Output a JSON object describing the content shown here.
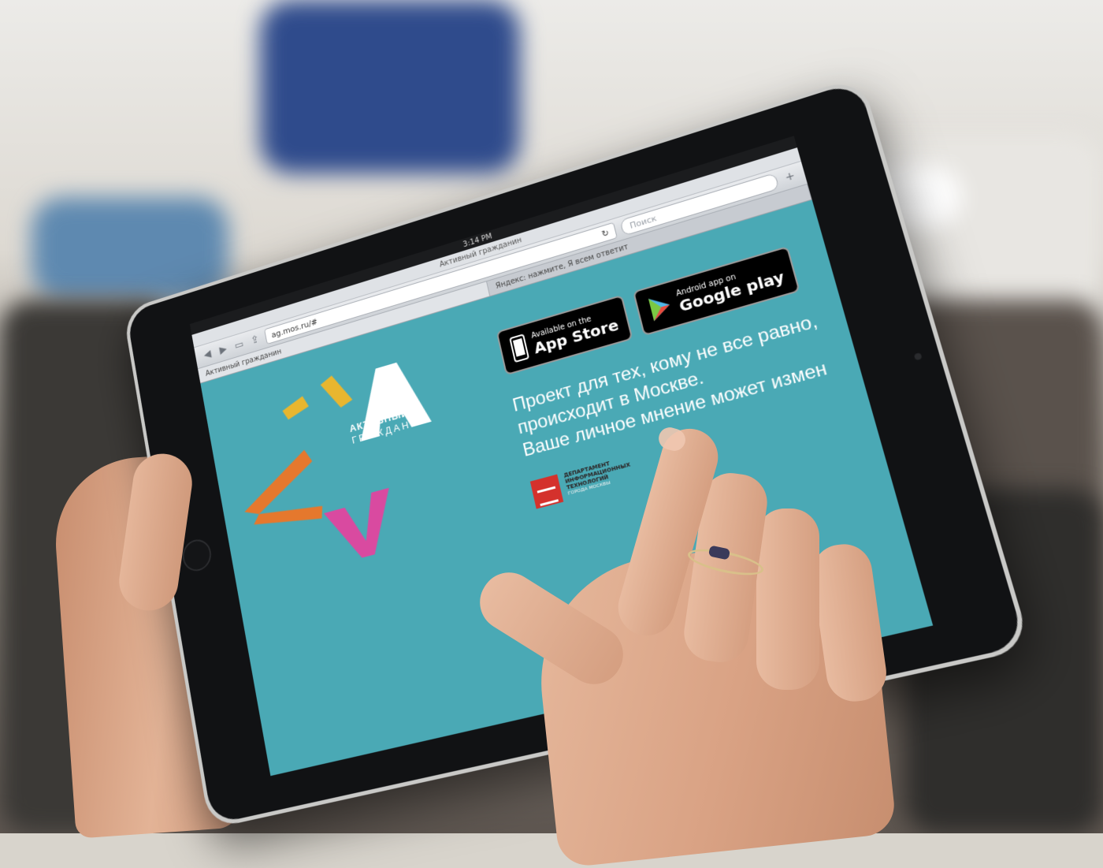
{
  "status_bar": {
    "left": "",
    "time": "3:14 PM",
    "battery": ""
  },
  "browser": {
    "page_title": "Активный гражданин",
    "url": "ag.mos.ru/#",
    "search_placeholder": "Поиск",
    "tabs": [
      {
        "label": "Активный гражданин"
      },
      {
        "label": "Яндекс: нажмите, Я всем ответит"
      }
    ]
  },
  "logo": {
    "line1": "АКТИВНЫЙ",
    "line2": "ГРАЖДАНИН"
  },
  "stores": {
    "app_store": {
      "small": "Available on the",
      "big": "App Store"
    },
    "google_play": {
      "small": "Android app on",
      "big": "Google play"
    }
  },
  "tagline": {
    "line1": "Проект для тех, кому не все равно,",
    "line2": "происходит в Москве.",
    "line3": "Ваше личное мнение может измен"
  },
  "department": {
    "name": "ДЕПАРТАМЕНТ ИНФОРМАЦИОННЫХ ТЕХНОЛОГИЙ",
    "sub": "ГОРОДА МОСКВЫ"
  },
  "colors": {
    "screen_bg": "#4aa9b5",
    "logo_orange": "#e5782d",
    "logo_yellow": "#e8b62f",
    "logo_pink": "#d94aa0"
  }
}
